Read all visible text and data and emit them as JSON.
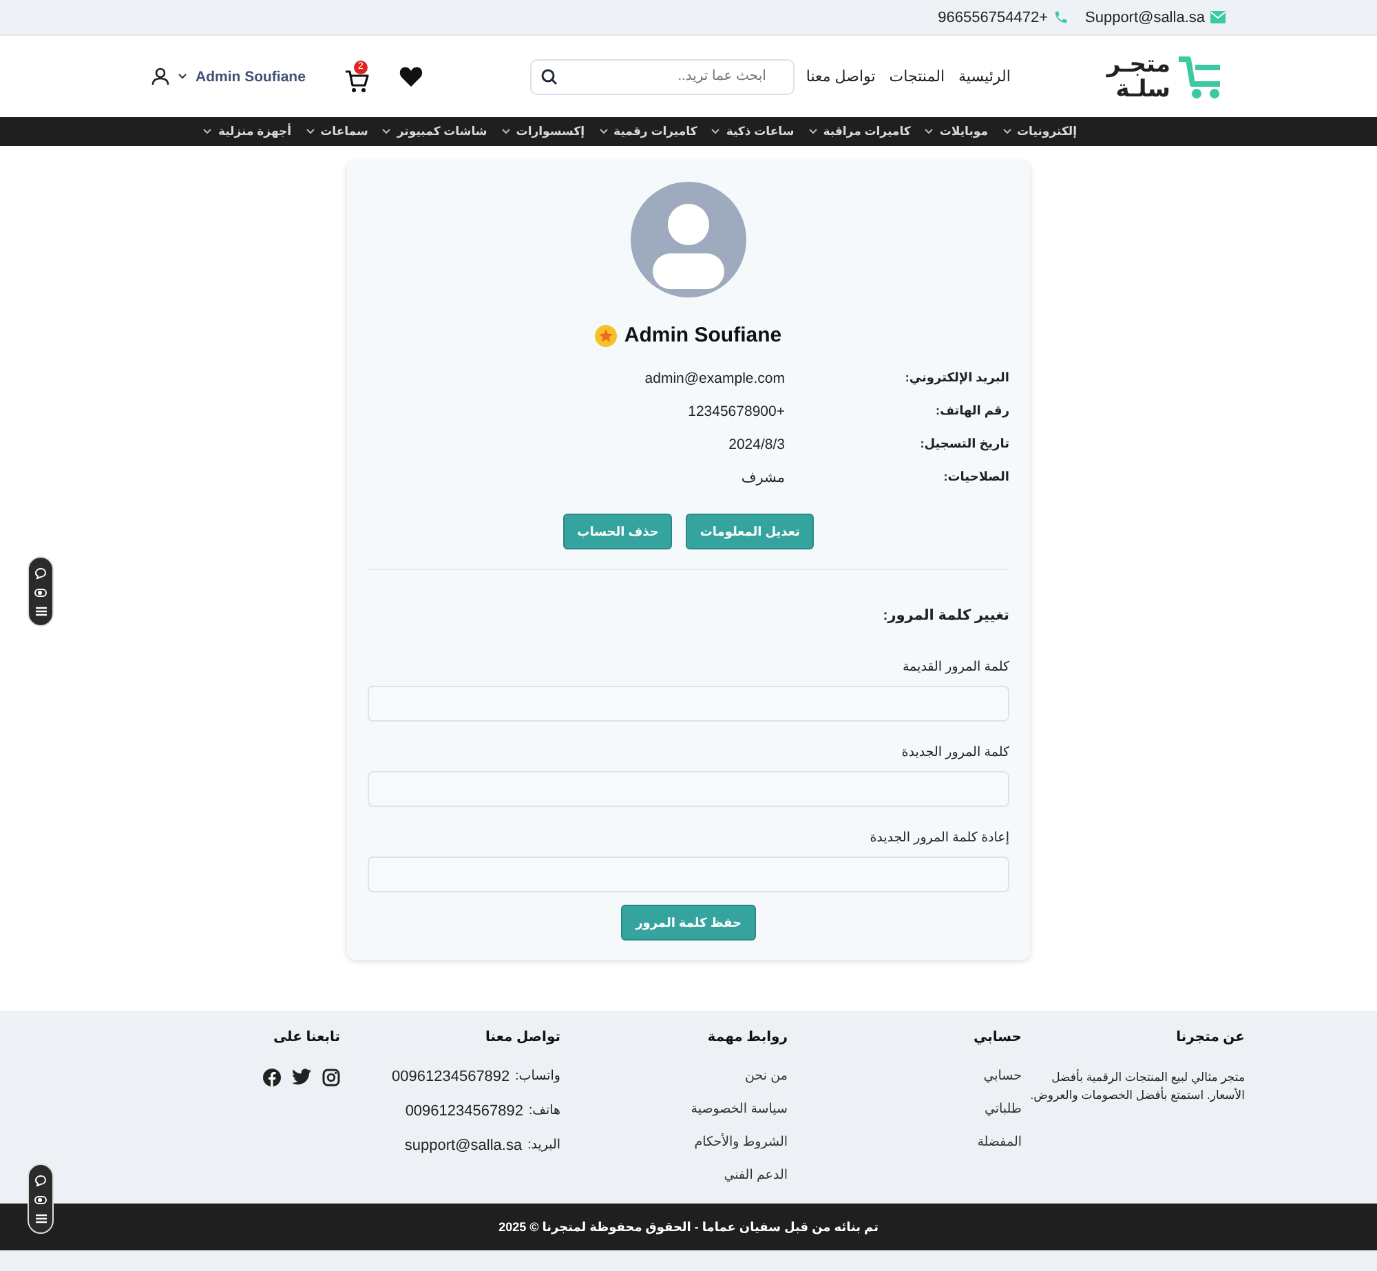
{
  "top_bar": {
    "email": "Support@salla.sa",
    "phone": "966556754472+"
  },
  "header": {
    "logo": {
      "line_1": "متجـر",
      "line_2": "سلـة"
    },
    "nav_links": [
      "الرئيسية",
      "المنتجات",
      "تواصل معنا"
    ],
    "search": {
      "placeholder": "ابحث عما تريد.."
    },
    "cart": {
      "count": "2"
    },
    "user": {
      "name": "Admin Soufiane"
    }
  },
  "categories": [
    "إلكترونيات",
    "موبايلات",
    "كاميرات مراقبة",
    "ساعات ذكية",
    "كاميرات رقمية",
    "إكسسوارات",
    "شاشات كمبيوتر",
    "سماعات",
    "أجهزة منزلية"
  ],
  "profile": {
    "name": "Admin Soufiane",
    "fields": [
      {
        "label": "البريد الإلكتروني:",
        "value": "admin@example.com"
      },
      {
        "label": "رقم الهاتف:",
        "value": "+12345678900"
      },
      {
        "label": "تاريخ التسجيل:",
        "value": "2024/8/3"
      },
      {
        "label": "الصلاحيات:",
        "value": "مشرف"
      }
    ],
    "buttons": [
      "تعديل المعلومات",
      "حذف الحساب"
    ]
  },
  "password": {
    "title": "تغيير كلمة المرور:",
    "fields": [
      "كلمة المرور القديمة",
      "كلمة المرور الجديدة",
      "إعادة كلمة المرور الجديدة"
    ],
    "submit": "حفظ كلمة المرور"
  },
  "footer": {
    "about": {
      "title": "عن متجرنا",
      "text": "متجر مثالي لبيع المنتجات الرقمية بأفضل الأسعار. استمتع بأفضل الخصومات والعروض."
    },
    "account": {
      "title": "حسابي",
      "links": [
        "حسابي",
        "طلباتي",
        "المفضلة"
      ]
    },
    "links": {
      "title": "روابط مهمة",
      "links": [
        "من نحن",
        "سياسة الخصوصية",
        "الشروط والأحكام",
        "الدعم الفني"
      ]
    },
    "contact": {
      "title": "تواصل معنا",
      "items": [
        {
          "label": "واتساب:",
          "value": "00961234567892"
        },
        {
          "label": "هاتف:",
          "value": "00961234567892"
        },
        {
          "label": "البريد:",
          "value": "support@salla.sa"
        }
      ]
    },
    "social": {
      "title": "تابعنا على"
    }
  },
  "copyright": "تم بنائه من قبل سفيان عماما - الحقوق محفوظة لمتجرنا © 2025"
}
